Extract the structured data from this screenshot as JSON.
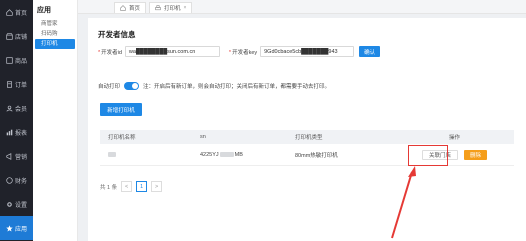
{
  "leftnav": {
    "items": [
      {
        "label": "首页",
        "icon": "home-icon"
      },
      {
        "label": "店铺",
        "icon": "store-icon"
      },
      {
        "label": "商品",
        "icon": "goods-icon"
      },
      {
        "label": "订单",
        "icon": "order-icon"
      },
      {
        "label": "会员",
        "icon": "member-icon"
      },
      {
        "label": "报表",
        "icon": "report-icon"
      },
      {
        "label": "营销",
        "icon": "marketing-icon"
      },
      {
        "label": "财务",
        "icon": "finance-icon"
      },
      {
        "label": "设置",
        "icon": "settings-icon"
      },
      {
        "label": "应用",
        "icon": "star-icon"
      }
    ]
  },
  "subnav": {
    "title": "应用",
    "items": [
      "商管家",
      "扫码购",
      "打印机"
    ]
  },
  "tabs": [
    {
      "label": "首页",
      "icon": "home-icon"
    },
    {
      "label": "打印机",
      "icon": "printer-icon",
      "close": "×"
    }
  ],
  "main": {
    "section_title": "开发者信息",
    "form": {
      "dev_id_label": "开发者id",
      "dev_id_value": "wa████████sun.com.cn",
      "dev_key_label": "开发者key",
      "dev_key_value": "9Gd0cbace5cb███████943",
      "confirm_label": "确认"
    },
    "auto_print": {
      "label": "自动打印",
      "hint": "注：开启后有新订单，则会自动打印；关闭后有新订单，都需要手动去打印。"
    },
    "new_printer_label": "新增打印机",
    "table": {
      "headers": [
        "打印机名称",
        "sn",
        "打印机类型",
        "操作"
      ],
      "rows": [
        {
          "sn_prefix": "4225YJ",
          "sn_suffix": "MB",
          "type": "80mm热敏打印机",
          "unbind_label": "关联门店",
          "delete_label": "删除"
        }
      ]
    },
    "pager": {
      "total": "共 1 条",
      "current": "1",
      "prev": "<",
      "next": ">"
    }
  },
  "colors": {
    "accent": "#1e88e5",
    "nav_bg": "#20222a",
    "delete": "#f59e1b",
    "annotation": "#e53935"
  }
}
